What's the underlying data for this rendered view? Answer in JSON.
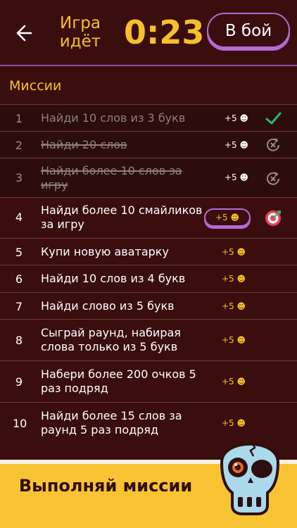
{
  "header": {
    "back_icon": "arrow-left-icon",
    "status": "Игра идёт",
    "timer": "0:23",
    "battle_label": "В бой"
  },
  "section": {
    "title": "Миссии"
  },
  "missions": [
    {
      "num": "1",
      "text": "Найди 10 слов из 3 букв",
      "reward": "+5 ☻",
      "state": "completed",
      "icon": "check-icon"
    },
    {
      "num": "2",
      "text": "Найди 20 слов",
      "reward": "+5 ☻",
      "state": "failed",
      "icon": "cancel-refresh-icon"
    },
    {
      "num": "3",
      "text": "Найди более 10 слов за игру",
      "reward": "+5 ☻",
      "state": "failed",
      "icon": "cancel-refresh-icon"
    },
    {
      "num": "4",
      "text": "Найди более 10 смайликов за игру",
      "reward": "+5 ☻",
      "state": "active",
      "icon": "target-icon"
    },
    {
      "num": "5",
      "text": "Купи новую аватарку",
      "reward": "+5 ☻",
      "state": "pending"
    },
    {
      "num": "6",
      "text": "Найди 10 слов из 4 букв",
      "reward": "+5 ☻",
      "state": "pending"
    },
    {
      "num": "7",
      "text": "Найди слово из 5 букв",
      "reward": "+5 ☻",
      "state": "pending"
    },
    {
      "num": "8",
      "text": "Сыграй раунд, набирая слова только из 5 букв",
      "reward": "+5 ☻",
      "state": "pending"
    },
    {
      "num": "9",
      "text": "Набери более 200 очков 5 раз подряд",
      "reward": "+5 ☻",
      "state": "pending"
    },
    {
      "num": "10",
      "text": "Найди более 15 слов за раунд 5 раз подряд",
      "reward": "+5 ☻",
      "state": "pending"
    }
  ],
  "bottom": {
    "label": "Выполняй миссии",
    "mascot": "skull-mascot"
  },
  "colors": {
    "background": "#3a0e0e",
    "accent": "#f6c02a",
    "purple": "#b56ad1",
    "banner": "#f8c333",
    "done_row": "#2d0c0c"
  }
}
